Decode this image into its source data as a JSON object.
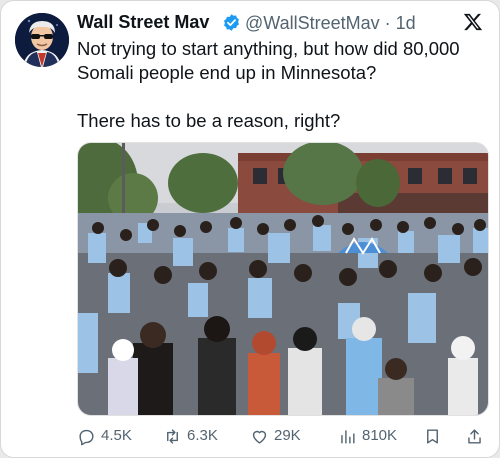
{
  "post": {
    "author_name": "Wall Street Mav",
    "handle": "@WallStreetMav",
    "time": "· 1d",
    "text_line1": "Not trying to start anything, but how did 80,000",
    "text_line2": "Somali people end up in Minnesota?",
    "text_line3": "There has to be a reason, right?"
  },
  "metrics": {
    "replies": "4.5K",
    "reposts": "6.3K",
    "likes": "29K",
    "views": "810K"
  },
  "icons": [
    "verified-badge-icon",
    "x-logo-icon",
    "reply-icon",
    "repost-icon",
    "like-icon",
    "views-icon",
    "bookmark-icon",
    "share-icon"
  ],
  "colors": {
    "verified": "#1d9bf0",
    "text": "#0f1419",
    "muted": "#536471"
  }
}
